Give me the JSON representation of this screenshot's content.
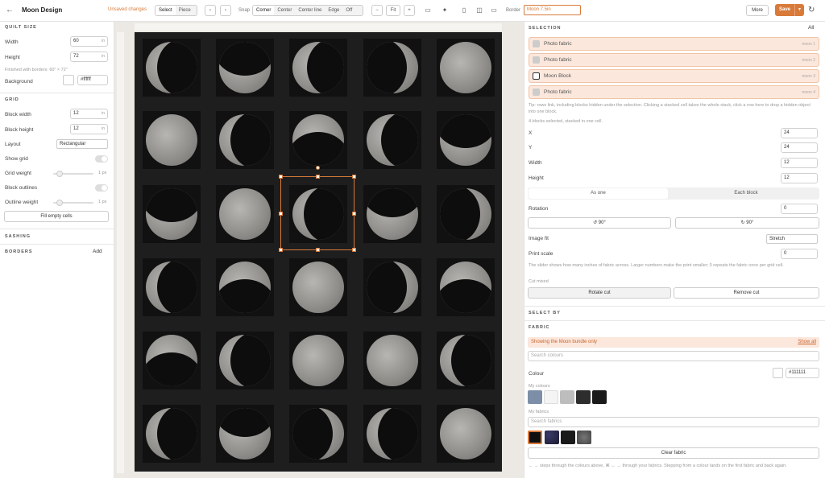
{
  "header": {
    "title": "Moon Design",
    "unsaved": "Unsaved changes",
    "tool_modes": [
      "Select",
      "Piece"
    ],
    "snap_label": "Snap",
    "snap_modes": [
      "Corner",
      "Center",
      "Center line",
      "Edge",
      "Off"
    ],
    "zoom_label": "Fit",
    "border_label": "Border",
    "border_value": "Moon 7.5in",
    "more_label": "More",
    "save_label": "Save"
  },
  "left": {
    "quilt_section": "QUILT SIZE",
    "width_label": "Width",
    "width_value": "60",
    "height_label": "Height",
    "height_value": "72",
    "unit": "in",
    "finished": "Finished with borders: 60\" × 72\"",
    "background_label": "Background",
    "background_value": "#ffffff",
    "grid_section": "GRID",
    "block_width_label": "Block width",
    "block_width_value": "12",
    "block_height_label": "Block height",
    "block_height_value": "12",
    "layout_label": "Layout",
    "layout_value": "Rectangular",
    "show_grid_label": "Show grid",
    "grid_weight_label": "Grid weight",
    "block_outlines_label": "Block outlines",
    "outline_weight_label": "Outline weight",
    "weight_value": "1 px",
    "fill_btn": "Fill empty cells",
    "sashing": "SASHING",
    "borders": "BORDERS",
    "add": "Add"
  },
  "right": {
    "selection_section": "SELECTION",
    "all": "All",
    "items": [
      {
        "name": "Photo fabric",
        "tag": "moon 1"
      },
      {
        "name": "Photo fabric",
        "tag": "moon 2"
      },
      {
        "name": "Moon Block",
        "tag": "moon 3"
      },
      {
        "name": "Photo fabric",
        "tag": "moon 4"
      }
    ],
    "note1": "Tip: rows link, including blocks hidden under the selection. Clicking a stacked cell takes the whole stack, click a row here to drop a hidden object into one block.",
    "note2": "4 blocks selected, stacked in one cell.",
    "x_label": "X",
    "x_value": "24",
    "y_label": "Y",
    "y_value": "24",
    "w_label": "Width",
    "w_value": "12",
    "h_label": "Height",
    "h_value": "12",
    "tab_all": "As one",
    "tab_each": "Each block",
    "rotation_label": "Rotation",
    "rotation_value": "0",
    "rot_ccw": "↺ 90°",
    "rot_cw": "↻ 90°",
    "image_fit_label": "Image fit",
    "image_fit_value": "Stretch",
    "print_scale_label": "Print scale",
    "print_scale_value": "0",
    "note3": "The slider shows how many inches of fabric across. Larger numbers make the print smaller; 0 repeats the fabric once per grid cell.",
    "cut_mode": "Cut mixed",
    "rotate_cut": "Rotate cut",
    "remove_cut": "Remove cut",
    "select_by": "SELECT BY",
    "fabric_section": "FABRIC",
    "banner": "Showing the Moon bundle only",
    "show_all": "Show all",
    "search_colours": "Search colours",
    "colour_label": "Colour",
    "colour_value": "#111111",
    "my_colours": "My colours",
    "my_fabrics": "My fabrics",
    "search_fabrics": "Search fabrics",
    "clear_fabric": "Clear fabric",
    "footer_note": "← → steps through the colours above, ⌘ ← → through your fabrics. Stepping from a colour lands on the first fabric and back again.",
    "colours": [
      "#7d8fa8",
      "#f4f4f4",
      "#bdbdbd",
      "#2d2d2d",
      "#1a1a1a"
    ]
  }
}
